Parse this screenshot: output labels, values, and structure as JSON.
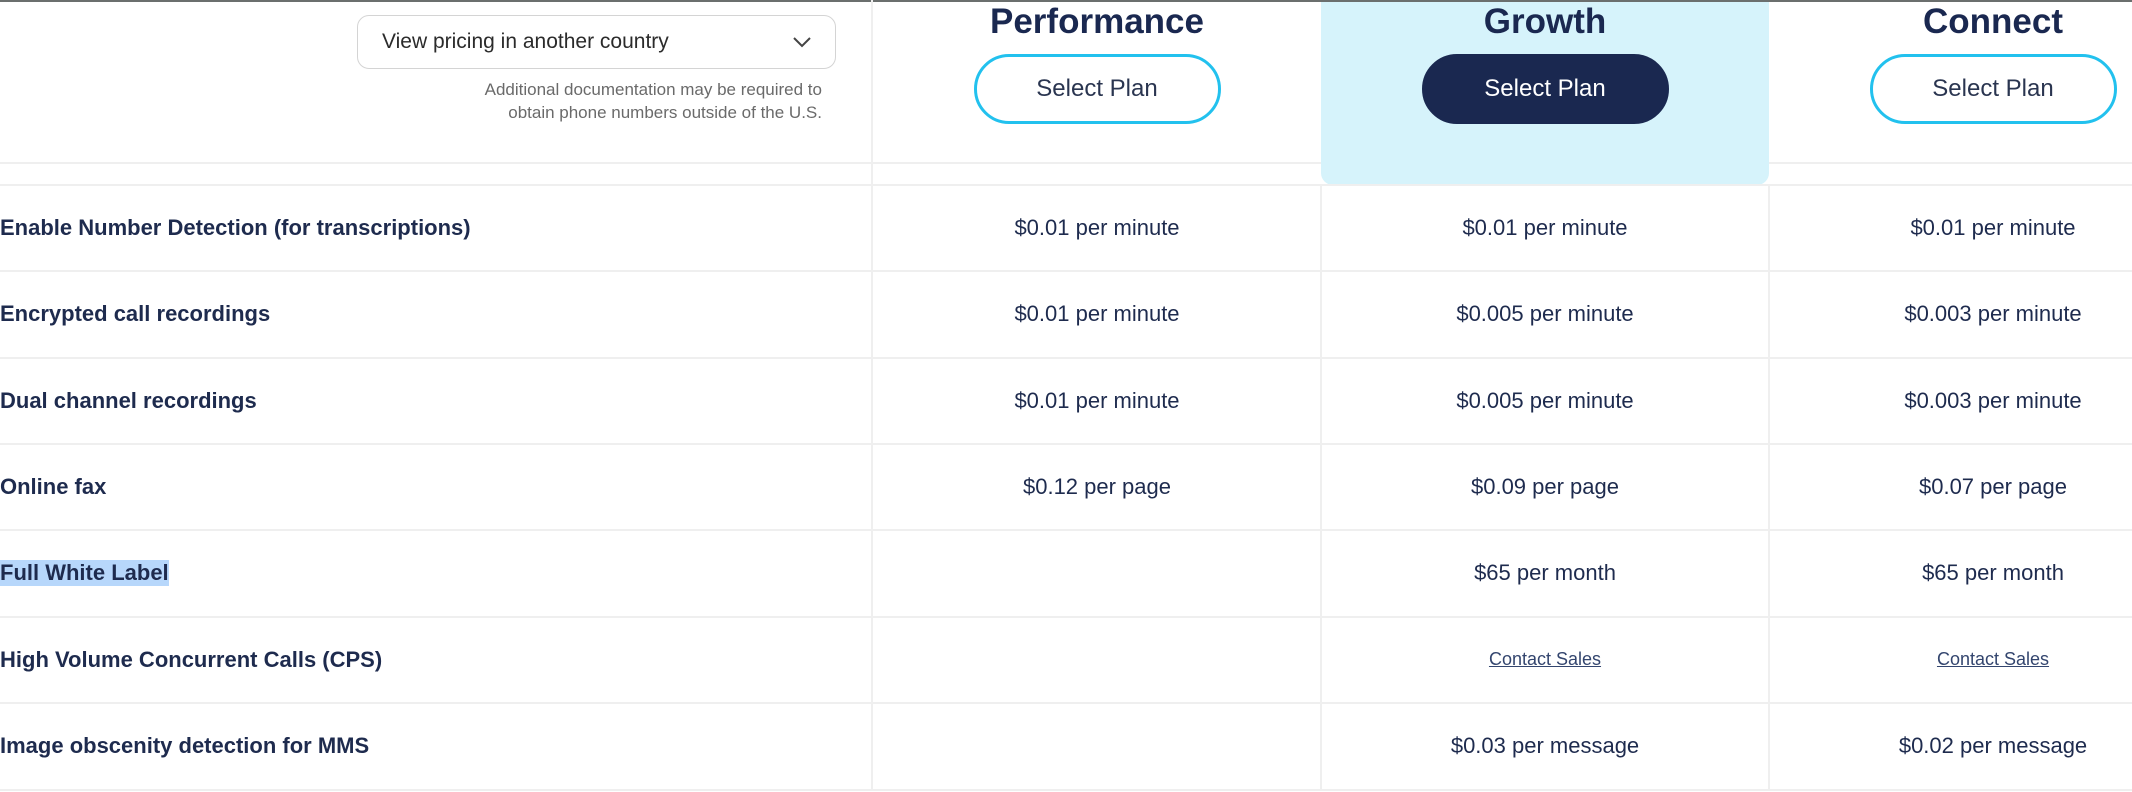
{
  "country_selector": {
    "label": "View pricing in another country",
    "note_line1": "Additional documentation may be required to",
    "note_line2": "obtain phone numbers outside of the U.S."
  },
  "plans": [
    {
      "name": "Performance",
      "button": "Select Plan",
      "highlighted": false
    },
    {
      "name": "Growth",
      "button": "Select Plan",
      "highlighted": true
    },
    {
      "name": "Connect",
      "button": "Select Plan",
      "highlighted": false
    }
  ],
  "colors": {
    "navy": "#1a2850",
    "accent_cyan": "#22c1ee",
    "highlight_bg": "#d6f3fb",
    "text_selection": "#b7d7fb"
  },
  "rows": [
    {
      "feature": "Enable Number Detection (for transcriptions)",
      "values": [
        "$0.01 per minute",
        "$0.01 per minute",
        "$0.01 per minute"
      ]
    },
    {
      "feature": "Encrypted call recordings",
      "values": [
        "$0.01 per minute",
        "$0.005 per minute",
        "$0.003 per minute"
      ]
    },
    {
      "feature": "Dual channel recordings",
      "values": [
        "$0.01 per minute",
        "$0.005 per minute",
        "$0.003 per minute"
      ]
    },
    {
      "feature": "Online fax",
      "values": [
        "$0.12 per page",
        "$0.09 per page",
        "$0.07 per page"
      ]
    },
    {
      "feature": "Full White Label",
      "selected": true,
      "values": [
        "",
        "$65 per month",
        "$65 per month"
      ]
    },
    {
      "feature": "High Volume Concurrent Calls (CPS)",
      "values": [
        "",
        "Contact Sales",
        "Contact Sales"
      ],
      "links": [
        false,
        true,
        true
      ]
    },
    {
      "feature": "Image obscenity detection for MMS",
      "values": [
        "",
        "$0.03 per message",
        "$0.02 per message"
      ]
    }
  ]
}
